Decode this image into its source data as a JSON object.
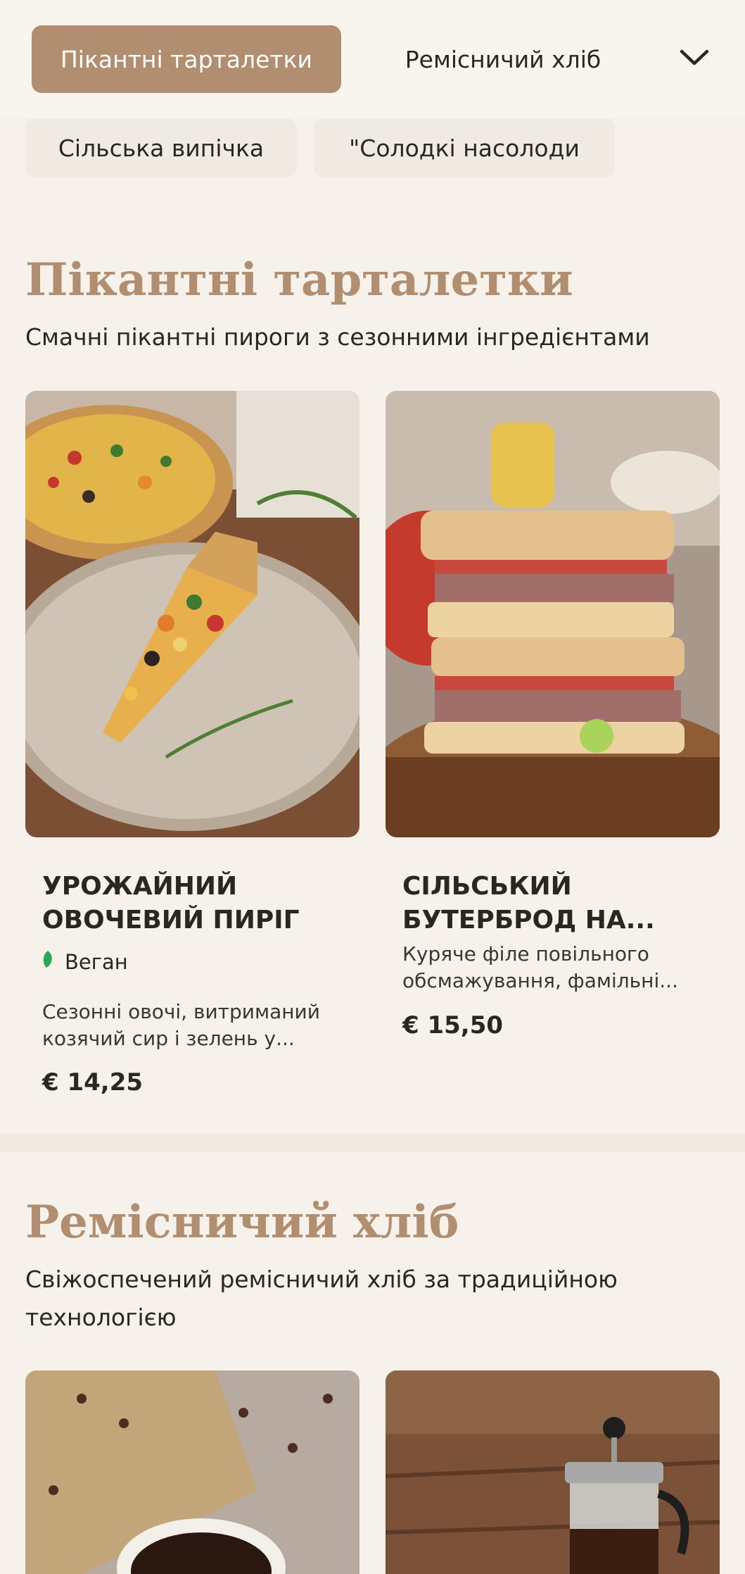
{
  "nav": {
    "categories": [
      "Пікантні тарталетки",
      "Ремісничий хліб",
      "Сільська випічка",
      "\"Солодкі насолоди"
    ],
    "active_index": 0,
    "expand_icon": "chevron-down-icon"
  },
  "colors": {
    "accent": "#b08e6f",
    "background": "#f6f1ea",
    "chip_bg": "#efebe2",
    "vegan_green": "#2fa45a"
  },
  "sections": [
    {
      "title": "Пікантні тарталетки",
      "description": "Смачні пікантні пироги з сезонними інгредієнтами",
      "products": [
        {
          "name": "УРОЖАЙНИЙ ОВОЧЕВИЙ ПИРІГ",
          "tag": "Веган",
          "tag_icon": "leaf-icon",
          "description": "Сезонні овочі, витриманий козячий сир і зелень у...",
          "price": "€ 14,25"
        },
        {
          "name": "СІЛЬСЬКИЙ БУТЕРБРОД НА...",
          "description": "Куряче філе повільного обсмажування, фамільні...",
          "price": "€ 15,50"
        }
      ]
    },
    {
      "title": "Ремісничий хліб",
      "description": "Свіжоспечений ремісничий хліб за традиційною технологією"
    }
  ]
}
